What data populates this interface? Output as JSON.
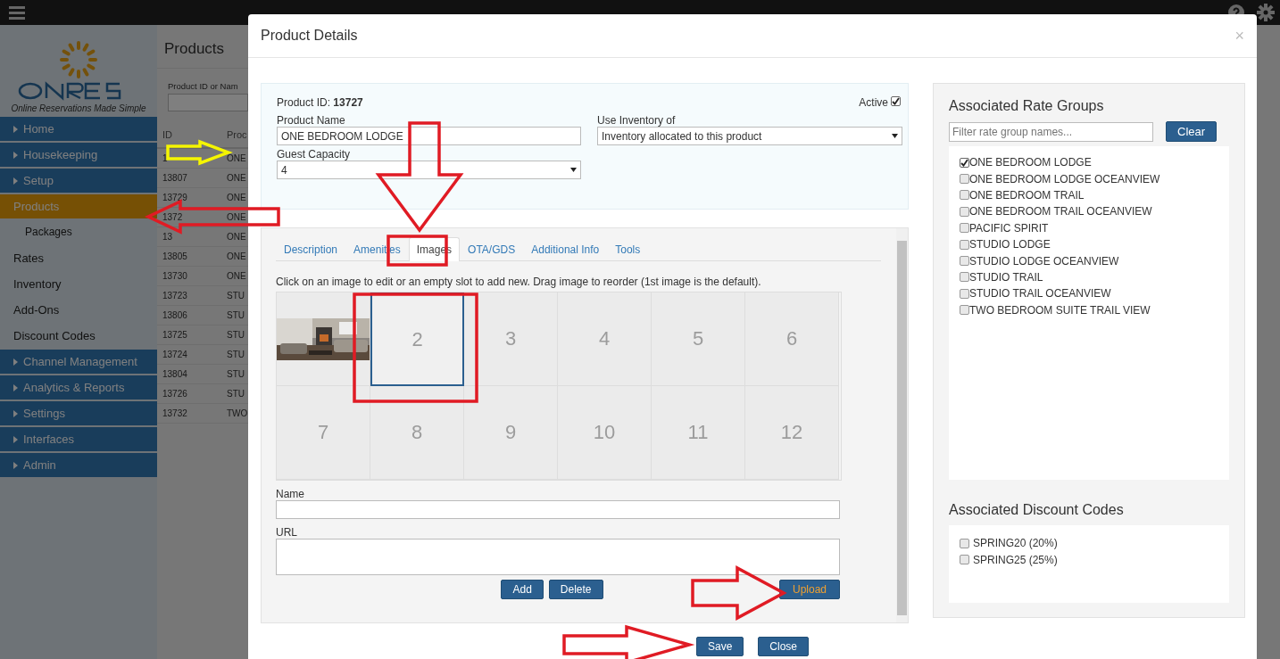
{
  "sidebar": {
    "tagline": "Online Reservations Made Simple",
    "items": [
      {
        "label": "Home",
        "kind": "section",
        "selected": false
      },
      {
        "label": "Housekeeping",
        "kind": "section",
        "selected": false
      },
      {
        "label": "Setup",
        "kind": "section",
        "selected": false
      },
      {
        "label": "Products",
        "kind": "link",
        "selected": true,
        "children": [
          {
            "label": "Packages",
            "selected": false
          }
        ]
      },
      {
        "label": "Rates",
        "kind": "link",
        "selected": false
      },
      {
        "label": "Inventory",
        "kind": "link",
        "selected": false
      },
      {
        "label": "Add-Ons",
        "kind": "link",
        "selected": false
      },
      {
        "label": "Discount Codes",
        "kind": "link",
        "selected": false
      },
      {
        "label": "Channel Management",
        "kind": "section",
        "selected": false
      },
      {
        "label": "Analytics & Reports",
        "kind": "section",
        "selected": false
      },
      {
        "label": "Settings",
        "kind": "section",
        "selected": false
      },
      {
        "label": "Interfaces",
        "kind": "section",
        "selected": false
      },
      {
        "label": "Admin",
        "kind": "section",
        "selected": false
      }
    ]
  },
  "products_page": {
    "title": "Products",
    "search_label": "Product ID or Nam",
    "columns": [
      "ID",
      "Proc"
    ],
    "rows": [
      [
        "1",
        "ONE"
      ],
      [
        "13807",
        "ONE"
      ],
      [
        "13729",
        "ONE"
      ],
      [
        "1372",
        "ONE"
      ],
      [
        "13",
        "ONE"
      ],
      [
        "13805",
        "ONE"
      ],
      [
        "13730",
        "ONE"
      ],
      [
        "13723",
        "STU"
      ],
      [
        "13806",
        "STU"
      ],
      [
        "13725",
        "STU"
      ],
      [
        "13724",
        "STU"
      ],
      [
        "13804",
        "STU"
      ],
      [
        "13726",
        "STU"
      ],
      [
        "13732",
        "TWO"
      ]
    ]
  },
  "dialog": {
    "title": "Product Details",
    "close": "×",
    "product": {
      "id_label": "Product ID:",
      "id": "13727",
      "active_label": "Active",
      "active": true,
      "name_label": "Product Name",
      "name": "ONE BEDROOM LODGE",
      "inventory_label": "Use Inventory of",
      "inventory": "Inventory allocated to this product",
      "capacity_label": "Guest Capacity",
      "capacity": "4"
    },
    "tabs": [
      {
        "label": "Description",
        "selected": false
      },
      {
        "label": "Amenities",
        "selected": false
      },
      {
        "label": "Images",
        "selected": true
      },
      {
        "label": "OTA/GDS",
        "selected": false
      },
      {
        "label": "Additional Info",
        "selected": false
      },
      {
        "label": "Tools",
        "selected": false
      }
    ],
    "images": {
      "hint": "Click on an image to edit or an empty slot to add new. Drag image to reorder (1st image is the default).",
      "slots": [
        {
          "kind": "picture",
          "selected": false
        },
        {
          "label": "2",
          "selected": true
        },
        {
          "label": "3",
          "selected": false
        },
        {
          "label": "4",
          "selected": false
        },
        {
          "label": "5",
          "selected": false
        },
        {
          "label": "6",
          "selected": false
        },
        {
          "label": "7",
          "selected": false
        },
        {
          "label": "8",
          "selected": false
        },
        {
          "label": "9",
          "selected": false
        },
        {
          "label": "10",
          "selected": false
        },
        {
          "label": "11",
          "selected": false
        },
        {
          "label": "12",
          "selected": false
        }
      ],
      "name_label": "Name",
      "url_label": "URL",
      "buttons": [
        "Add",
        "Delete"
      ],
      "upload": "Upload"
    },
    "rate_groups": {
      "title": "Associated Rate Groups",
      "filter_placeholder": "Filter rate group names...",
      "clear": "Clear",
      "items": [
        {
          "label": "ONE BEDROOM LODGE",
          "checked": true
        },
        {
          "label": "ONE BEDROOM LODGE OCEANVIEW",
          "checked": false
        },
        {
          "label": "ONE BEDROOM TRAIL",
          "checked": false
        },
        {
          "label": "ONE BEDROOM TRAIL OCEANVIEW",
          "checked": false
        },
        {
          "label": "PACIFIC SPIRIT",
          "checked": false
        },
        {
          "label": "STUDIO LODGE",
          "checked": false
        },
        {
          "label": "STUDIO LODGE OCEANVIEW",
          "checked": false
        },
        {
          "label": "STUDIO TRAIL",
          "checked": false
        },
        {
          "label": "STUDIO TRAIL OCEANVIEW",
          "checked": false
        },
        {
          "label": "TWO BEDROOM SUITE TRAIL VIEW",
          "checked": false
        }
      ]
    },
    "discount_codes": {
      "title": "Associated Discount Codes",
      "items": [
        {
          "label": "SPRING20 (20%)",
          "checked": false
        },
        {
          "label": "SPRING25 (25%)",
          "checked": false
        }
      ]
    },
    "footer_buttons": [
      "Save",
      "Close"
    ]
  }
}
